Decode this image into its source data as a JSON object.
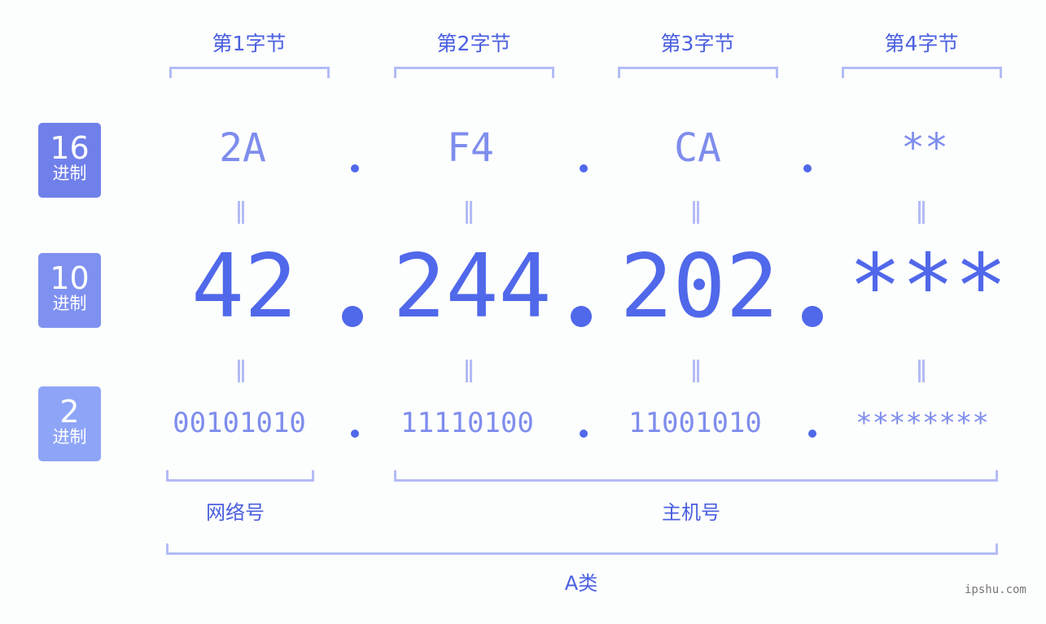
{
  "byte_headers": [
    "第1字节",
    "第2字节",
    "第3字节",
    "第4字节"
  ],
  "badges": [
    {
      "num": "16",
      "label": "进制",
      "color": "#7080ea"
    },
    {
      "num": "10",
      "label": "进制",
      "color": "#7f91f0"
    },
    {
      "num": "2",
      "label": "进制",
      "color": "#8ea5f7"
    }
  ],
  "hex": [
    "2A",
    "F4",
    "CA",
    "**"
  ],
  "dec": [
    "42",
    "244",
    "202",
    "***"
  ],
  "bin": [
    "00101010",
    "11110100",
    "11001010",
    "********"
  ],
  "segments": {
    "network": "网络号",
    "host": "主机号"
  },
  "class_label": "A类",
  "watermark": "ipshu.com",
  "colors": {
    "primary": "#5068ea",
    "light": "#7e8ded",
    "bracket": "#b3bcf5"
  }
}
